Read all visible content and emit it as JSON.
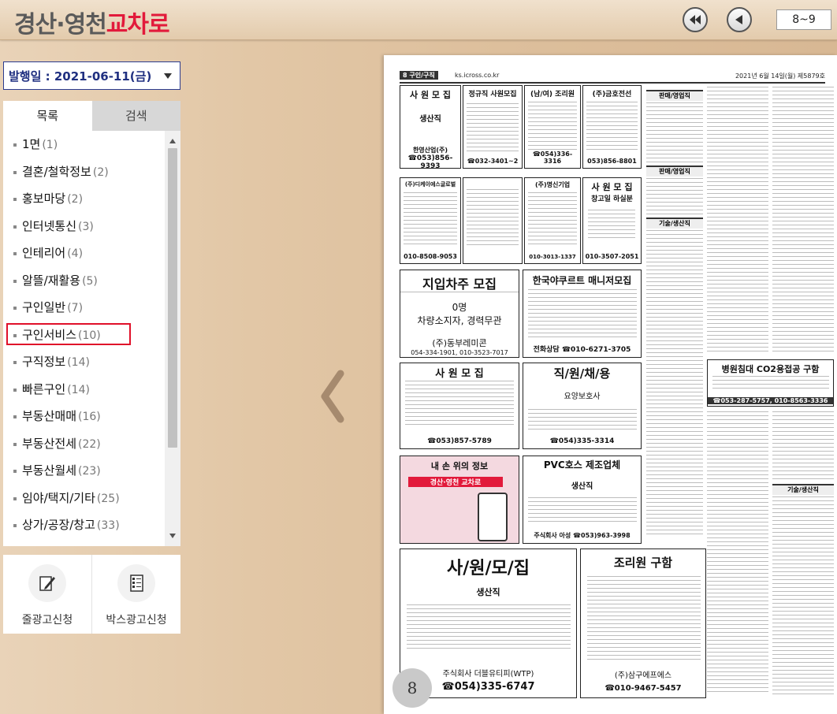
{
  "app": {
    "logo_part1": "경산·영천",
    "logo_part2": "교차로",
    "page_range": "8~9"
  },
  "date_select": {
    "label": "발행일 : 2021-06-11(금)"
  },
  "tabs": [
    {
      "label": "목록",
      "active": true
    },
    {
      "label": "검색",
      "active": false
    }
  ],
  "categories": [
    {
      "name": "1면",
      "count": "(1)"
    },
    {
      "name": "결혼/철학정보",
      "count": "(2)"
    },
    {
      "name": "홍보마당",
      "count": "(2)"
    },
    {
      "name": "인터넷통신",
      "count": "(3)"
    },
    {
      "name": "인테리어",
      "count": "(4)"
    },
    {
      "name": "알뜰/재활용",
      "count": "(5)"
    },
    {
      "name": "구인일반",
      "count": "(7)"
    },
    {
      "name": "구인서비스",
      "count": "(10)",
      "selected": true
    },
    {
      "name": "구직정보",
      "count": "(14)"
    },
    {
      "name": "빠른구인",
      "count": "(14)"
    },
    {
      "name": "부동산매매",
      "count": "(16)"
    },
    {
      "name": "부동산전세",
      "count": "(22)"
    },
    {
      "name": "부동산월세",
      "count": "(23)"
    },
    {
      "name": "임야/택지/기타",
      "count": "(25)"
    },
    {
      "name": "상가/공장/창고",
      "count": "(33)"
    }
  ],
  "actions": {
    "line_ad": "줄광고신청",
    "box_ad": "박스광고신청"
  },
  "paper": {
    "section": "8 구인/구직",
    "url": "ks.icross.co.kr",
    "date": "2021년 6월 14일(월) 제5879호",
    "page_number": "8",
    "ads": {
      "a1_title": "사 원 모 집",
      "a1_sub": "생산직",
      "a1_company": "한영산업(주)",
      "a1_phone": "☎053)856-9393",
      "a2_title": "정규직 사원모집",
      "a2_phone": "☎032-3401~2",
      "a3_title": "(남/여) 조리원",
      "a3_phone": "☎054)336-3316",
      "a4_title": "(주)금호전선",
      "a4_phone": "053)856-8801",
      "b1_title": "(주)디케이에스글로벌",
      "b1_phone": "010-8508-9053",
      "b2_title": "(주)명신기업",
      "b2_phone": "010-3013-1337",
      "b3_title": "사 원 모 집",
      "b3_sub": "창고일 하실분",
      "b3_phone": "010-3507-2051",
      "c1_title": "지입차주 모집",
      "c1_line1": "0명",
      "c1_line2": "차량소지자, 경력무관",
      "c1_company": "(주)동부레미콘",
      "c1_phone": "054-334-1901, 010-3523-7017",
      "c2_title": "한국야쿠르트 매니저모집",
      "c2_phone": "전화상담 ☎010-6271-3705",
      "d1_title": "사 원 모 집",
      "d1_phone": "☎053)857-5789",
      "d2_title": "직/원/채/용",
      "d2_sub": "요양보호사",
      "d2_phone": "☎054)335-3314",
      "e1_title": "내 손 위의 정보",
      "e1_logo": "경산·영천 교차로",
      "e2_title": "PVC호스 제조업체",
      "e2_sub": "생산직",
      "e2_phone": "주식회사 아성 ☎053)963-3998",
      "f1_title": "사/원/모/집",
      "f1_sub": "생산직",
      "f1_company": "주식회사 더블유티피(WTP)",
      "f1_phone": "☎054)335-6747",
      "f2_title": "조리원 구함",
      "f2_company": "(주)삼구에프에스",
      "f2_phone": "☎010-9467-5457",
      "g1_title": "병원침대 CO2용접공 구함",
      "g1_phone": "☎053-287-5757, 010-8563-3336",
      "s1": "판매/영업직",
      "s2": "기술/생산직",
      "s3": "기술/생산직"
    }
  },
  "colors": {
    "brand_red": "#e21a3b",
    "select_border": "#2b3b8f",
    "highlight": "#e0102a"
  }
}
